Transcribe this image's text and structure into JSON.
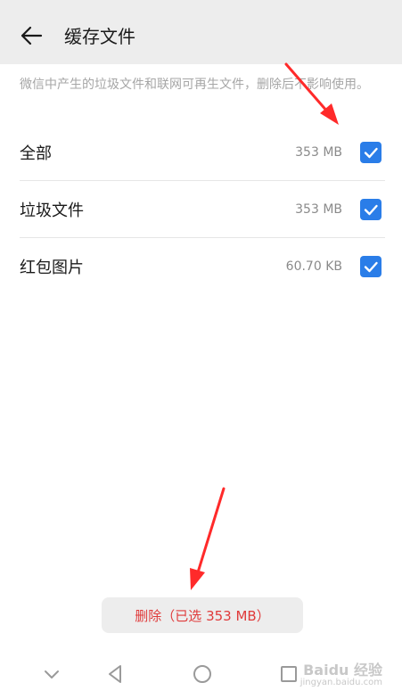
{
  "header": {
    "title": "缓存文件"
  },
  "description": "微信中产生的垃圾文件和联网可再生文件，删除后不影响使用。",
  "items": [
    {
      "label": "全部",
      "size": "353 MB",
      "checked": true
    },
    {
      "label": "垃圾文件",
      "size": "353 MB",
      "checked": true
    },
    {
      "label": "红包图片",
      "size": "60.70 KB",
      "checked": true
    }
  ],
  "delete_button": {
    "label": "删除（已选 353 MB）"
  },
  "watermark": {
    "text": "Baidu 经验",
    "sub": "jingyan.baidu.com"
  },
  "colors": {
    "accent": "#2a7de8",
    "danger": "#e03a3a",
    "header_bg": "#ededed",
    "annotation_arrow": "#ff2a2a"
  },
  "icons": {
    "back": "back-arrow-icon",
    "check": "checkmark-icon",
    "nav_down": "chevron-down-icon",
    "nav_back": "triangle-back-icon",
    "nav_home": "circle-home-icon",
    "nav_recent": "square-recent-icon"
  }
}
